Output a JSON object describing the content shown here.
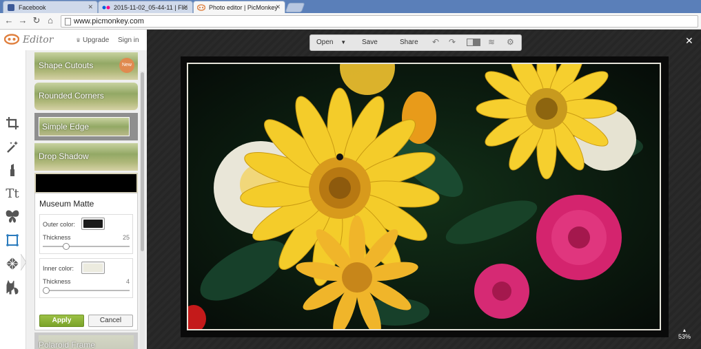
{
  "browser": {
    "tabs": [
      {
        "label": "Facebook"
      },
      {
        "label": "2015-11-02_05-44-11 | Flic"
      },
      {
        "label": "Photo editor | PicMonkey"
      }
    ],
    "url": "www.picmonkey.com"
  },
  "editor": {
    "title": "Editor",
    "upgrade": "Upgrade",
    "sign_in": "Sign in"
  },
  "effects": {
    "shape_cutouts": "Shape Cutouts",
    "new_badge": "New",
    "rounded_corners": "Rounded Corners",
    "simple_edge": "Simple Edge",
    "drop_shadow": "Drop Shadow",
    "polaroid_frame": "Polaroid Frame"
  },
  "museum_matte": {
    "title": "Museum Matte",
    "outer_color_label": "Outer color:",
    "outer_color": "#1b1b1b",
    "outer_thickness_label": "Thickness",
    "outer_thickness": "25",
    "outer_thickness_fraction": 0.25,
    "inner_color_label": "Inner color:",
    "inner_color": "#ecebdf",
    "inner_thickness_label": "Thickness",
    "inner_thickness": "4",
    "inner_thickness_fraction": 0.0,
    "apply": "Apply",
    "cancel": "Cancel"
  },
  "toolbar": {
    "open": "Open",
    "save": "Save",
    "share": "Share"
  },
  "zoom": "53%",
  "colors": {
    "accent_green": "#8cb63c",
    "active_tool": "#2a7bbd",
    "facebook": "#3b5998"
  }
}
